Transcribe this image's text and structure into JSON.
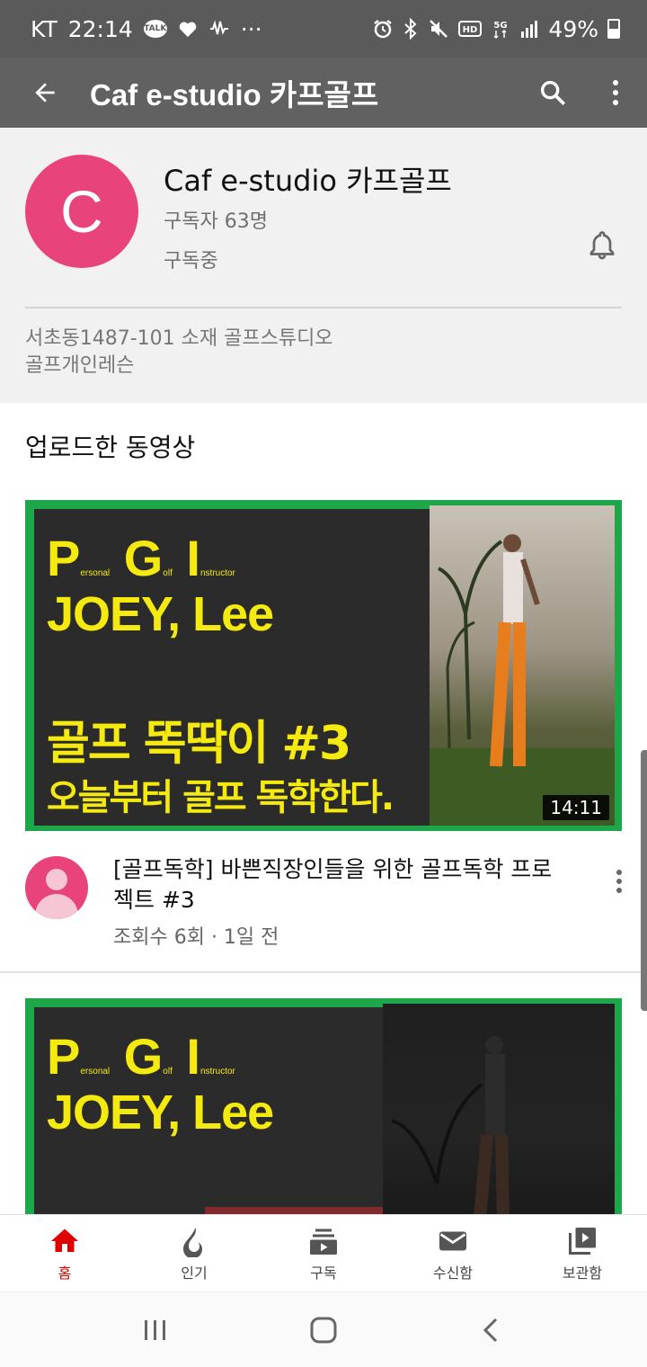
{
  "status_bar": {
    "carrier": "KT",
    "time": "22:14",
    "battery": "49%",
    "left_icons": [
      "talk-icon",
      "heart-icon",
      "signal-wave-icon",
      "more-dots-icon"
    ],
    "right_icons": [
      "alarm-icon",
      "bluetooth-icon",
      "mute-icon",
      "hd-icon",
      "5g-icon",
      "cell-signal-icon",
      "battery-icon"
    ],
    "talk_label": "TALK",
    "more_label": "···"
  },
  "app_bar": {
    "title": "Caf e-studio 카프골프",
    "icons": [
      "back-arrow-icon",
      "search-icon",
      "more-vert-icon"
    ]
  },
  "channel": {
    "avatar_letter": "C",
    "avatar_color": "#e8437b",
    "name": "Caf e-studio 카프골프",
    "subscribers": "구독자 63명",
    "subscribe_status": "구독중",
    "description_line1": "서초동1487-101 소재 골프스튜디오",
    "description_line2": "골프개인레슨"
  },
  "section": {
    "title": "업로드한 동영상"
  },
  "videos": [
    {
      "thumb_pgi_p": "P",
      "thumb_pgi_p_small": "ersonal",
      "thumb_pgi_g": "G",
      "thumb_pgi_g_small": "olf",
      "thumb_pgi_i": "I",
      "thumb_pgi_i_small": "nstructor",
      "thumb_name": "JOEY, Lee",
      "thumb_headline": "골프 똑딱이 #3",
      "thumb_subline": "오늘부터 골프 독학한다.",
      "duration": "14:11",
      "title": "[골프독학]  바쁜직장인들을 위한 골프독학 프로젝트 #3",
      "meta": "조회수 6회 · 1일 전"
    },
    {
      "thumb_pgi_p": "P",
      "thumb_pgi_p_small": "ersonal",
      "thumb_pgi_g": "G",
      "thumb_pgi_g_small": "olf",
      "thumb_pgi_i": "I",
      "thumb_pgi_i_small": "nstructor",
      "thumb_name": "JOEY, Lee"
    }
  ],
  "bottom_nav": [
    {
      "label": "홈",
      "icon": "home-icon",
      "active": true
    },
    {
      "label": "인기",
      "icon": "flame-icon",
      "active": false
    },
    {
      "label": "구독",
      "icon": "subscriptions-icon",
      "active": false
    },
    {
      "label": "수신함",
      "icon": "mail-icon",
      "active": false
    },
    {
      "label": "보관함",
      "icon": "library-icon",
      "active": false
    }
  ],
  "system_nav": [
    "recent-apps-icon",
    "home-button-icon",
    "back-nav-icon"
  ],
  "colors": {
    "accent_red": "#e00000",
    "app_bar": "#616161",
    "thumb_text_yellow": "#f5ea10",
    "thumb_border_green": "#1ea64a"
  }
}
